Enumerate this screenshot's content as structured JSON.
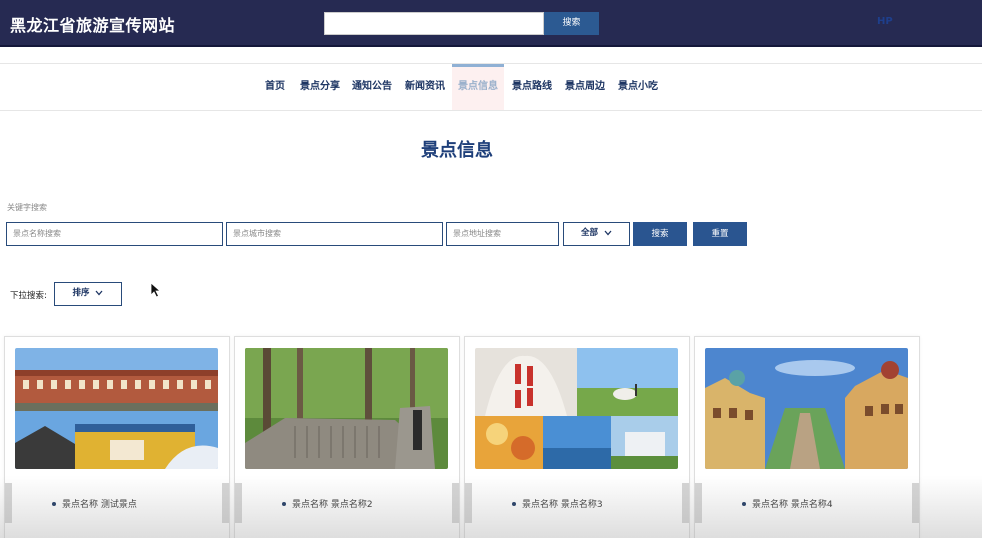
{
  "header": {
    "site_title": "黑龙江省旅游宣传网站",
    "search_placeholder": "",
    "search_button": "搜索",
    "right_link": "HP"
  },
  "nav": {
    "items": [
      {
        "label": "首页"
      },
      {
        "label": "景点分享"
      },
      {
        "label": "通知公告"
      },
      {
        "label": "新闻资讯"
      },
      {
        "label": "景点信息",
        "active": true
      },
      {
        "label": "景点路线"
      },
      {
        "label": "景点周边"
      },
      {
        "label": "景点小吃"
      }
    ]
  },
  "page": {
    "heading": "景点信息"
  },
  "filters": {
    "keyword_label": "关键字搜索",
    "name_placeholder": "景点名称搜索",
    "city_placeholder": "景点城市搜索",
    "address_placeholder": "景点地址搜索",
    "category_value": "全部",
    "search_button": "搜索",
    "reset_button": "重置",
    "sort_label": "下拉搜索:",
    "sort_value": "排序"
  },
  "cards": [
    {
      "name": "景点名称 测试景点"
    },
    {
      "name": "景点名称 景点名称2"
    },
    {
      "name": "景点名称 景点名称3"
    },
    {
      "name": "景点名称 景点名称4"
    }
  ],
  "colors": {
    "topbar_bg": "#262a52",
    "accent": "#2a5590",
    "heading": "#1e3f7a",
    "nav_text": "#1d3563",
    "nav_active_bg": "#fdf0f0"
  }
}
